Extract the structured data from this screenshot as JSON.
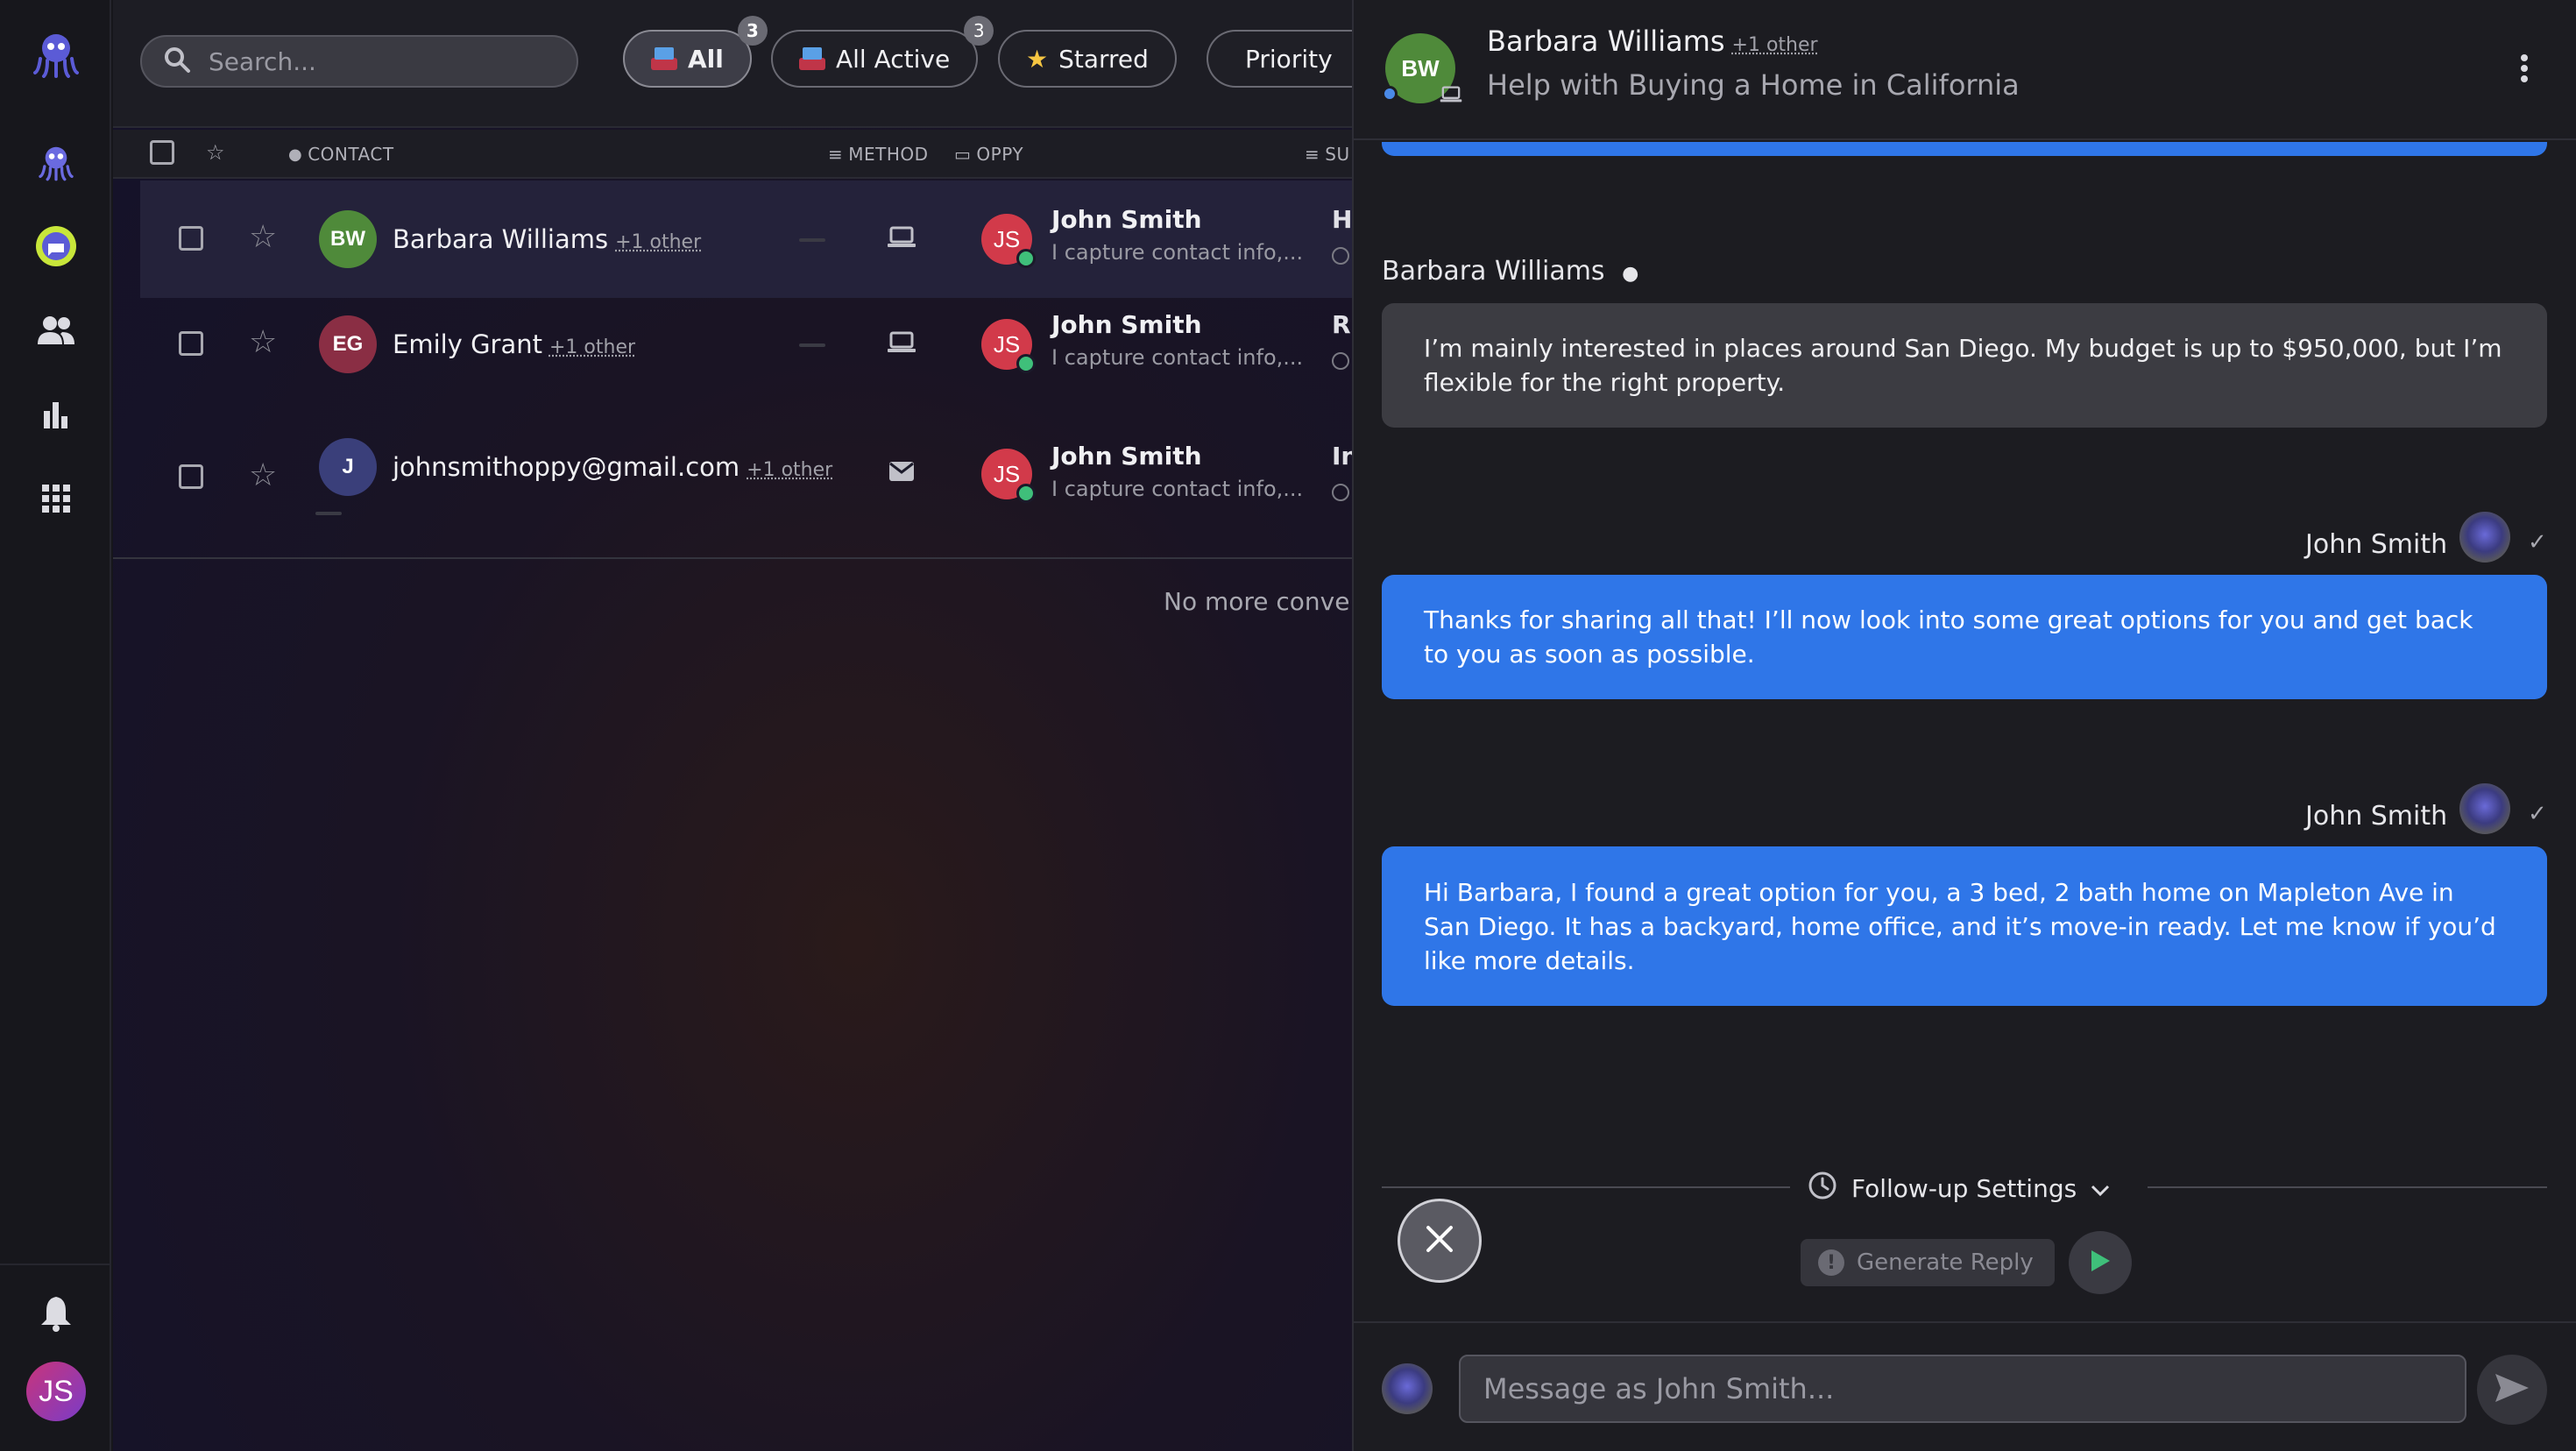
{
  "search": {
    "placeholder": "Search..."
  },
  "filters": [
    {
      "label": "All",
      "badge": "3",
      "icon": "inbox-tray-icon"
    },
    {
      "label": "All Active",
      "badge": "3",
      "icon": "inbox-tray-icon"
    },
    {
      "label": "Starred",
      "icon": "star-emoji-icon"
    },
    {
      "label": "Priority",
      "icon": "red-circle-icon"
    }
  ],
  "columns": {
    "contact": "CONTACT",
    "method": "METHOD",
    "oppy": "OPPY",
    "summary": "SU"
  },
  "rows": [
    {
      "initials": "BW",
      "name": "Barbara Williams",
      "extra": "+1 other",
      "method": "laptop-icon",
      "agent": "John Smith",
      "agent_initials": "JS",
      "preview": "I capture contact info,...",
      "summary_initial": "H"
    },
    {
      "initials": "EG",
      "name": "Emily Grant",
      "extra": "+1 other",
      "method": "laptop-icon",
      "agent": "John Smith",
      "agent_initials": "JS",
      "preview": "I capture contact info,...",
      "summary_initial": "R"
    },
    {
      "initials": "J",
      "name": "johnsmithoppy@gmail.com",
      "extra": "+1 other",
      "method": "mail-icon",
      "agent": "John Smith",
      "agent_initials": "JS",
      "preview": "I capture contact info,...",
      "summary_initial": "In"
    }
  ],
  "list_footer": "No more conver",
  "conversation": {
    "contact_initials": "BW",
    "contact_name": "Barbara Williams",
    "contact_extra": "+1 other",
    "subject": "Help with Buying a Home in California",
    "messages": [
      {
        "sender": "Barbara Williams",
        "direction": "in",
        "text": "I’m mainly interested in places around San Diego. My budget is up to $950,000, but I’m flexible for the right property."
      },
      {
        "sender": "John Smith",
        "direction": "out",
        "text": "Thanks for sharing all that! I’ll now look into some great options for you and get back to you as soon as possible."
      },
      {
        "sender": "John Smith",
        "direction": "out",
        "text": "Hi Barbara, I found a great option for you, a 3 bed, 2 bath home on Mapleton Ave in San Diego. It has a backyard, home office, and it’s move-in ready. Let me know if you’d like more details."
      }
    ],
    "follow_up_label": "Follow-up Settings",
    "generate_label": "Generate Reply",
    "composer_placeholder": "Message as John Smith..."
  },
  "user": {
    "initials": "JS"
  },
  "colors": {
    "accent": "#2f76e8",
    "brand": "#5b5bd6",
    "agent_avatar": "#d23a4a",
    "bw_avatar": "#4f8a3a",
    "eg_avatar": "#8a2e44",
    "j_avatar": "#3a3f7a",
    "online": "#3fbf7a"
  }
}
